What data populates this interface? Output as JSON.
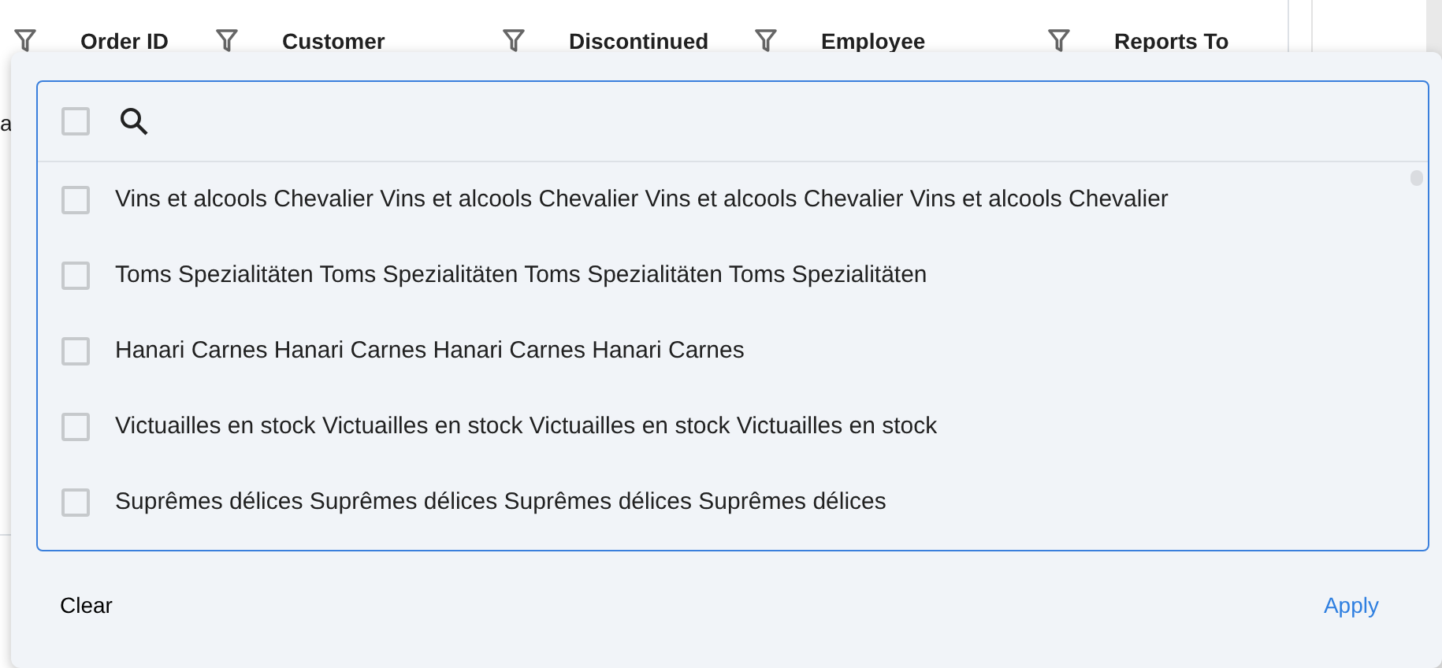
{
  "grid": {
    "columns": [
      {
        "label": "Order ID"
      },
      {
        "label": "Customer"
      },
      {
        "label": "Discontinued"
      },
      {
        "label": "Employee"
      },
      {
        "label": "Reports To"
      }
    ],
    "cell_fragment": "a"
  },
  "filter_popup": {
    "select_all": {
      "checked": false
    },
    "items": [
      {
        "label": "Vins et alcools Chevalier Vins et alcools Chevalier Vins et alcools Chevalier Vins et alcools Chevalier",
        "checked": false
      },
      {
        "label": "Toms Spezialitäten Toms Spezialitäten Toms Spezialitäten Toms Spezialitäten",
        "checked": false
      },
      {
        "label": "Hanari Carnes Hanari Carnes Hanari Carnes Hanari Carnes",
        "checked": false
      },
      {
        "label": "Victuailles en stock Victuailles en stock Victuailles en stock Victuailles en stock",
        "checked": false
      },
      {
        "label": "Suprêmes délices Suprêmes délices Suprêmes délices Suprêmes délices",
        "checked": false
      }
    ],
    "buttons": [
      {
        "label": "Clear",
        "kind": "plain"
      },
      {
        "label": "Apply",
        "kind": "primary"
      }
    ]
  }
}
